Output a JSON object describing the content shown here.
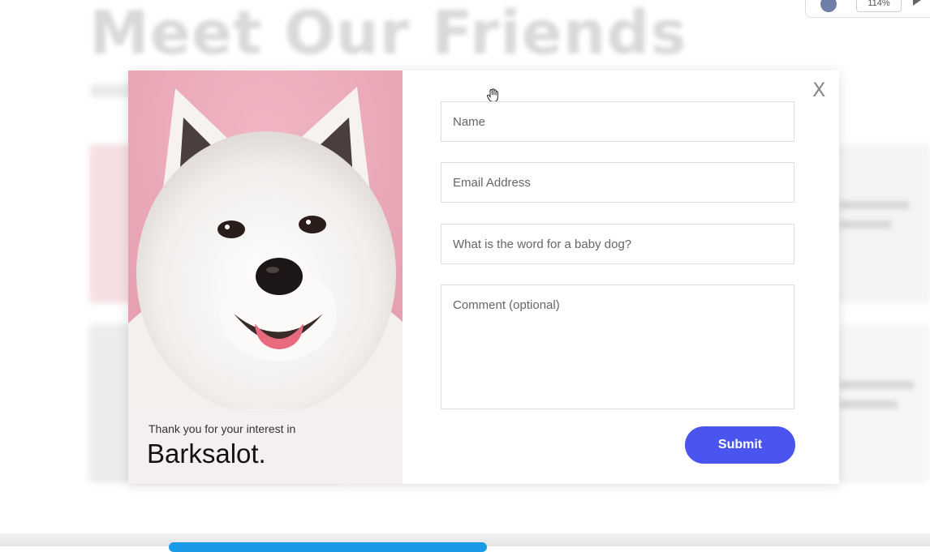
{
  "background": {
    "heading": "Meet Our Friends"
  },
  "browser": {
    "zoom": "114%"
  },
  "modal": {
    "close_label": "X",
    "caption_small": "Thank you for your interest in",
    "caption_brand": "Barksalot.",
    "form": {
      "name_placeholder": "Name",
      "email_placeholder": "Email Address",
      "riddle_placeholder": "What is the word for a baby dog?",
      "comment_placeholder": "Comment (optional)",
      "submit_label": "Submit"
    }
  },
  "colors": {
    "accent": "#4a55f0",
    "image_background": "#eaa8b6",
    "bottom_bar": "#1a9be8"
  },
  "icons": {
    "cursor": "hand-cursor-icon",
    "play": "play-icon"
  }
}
